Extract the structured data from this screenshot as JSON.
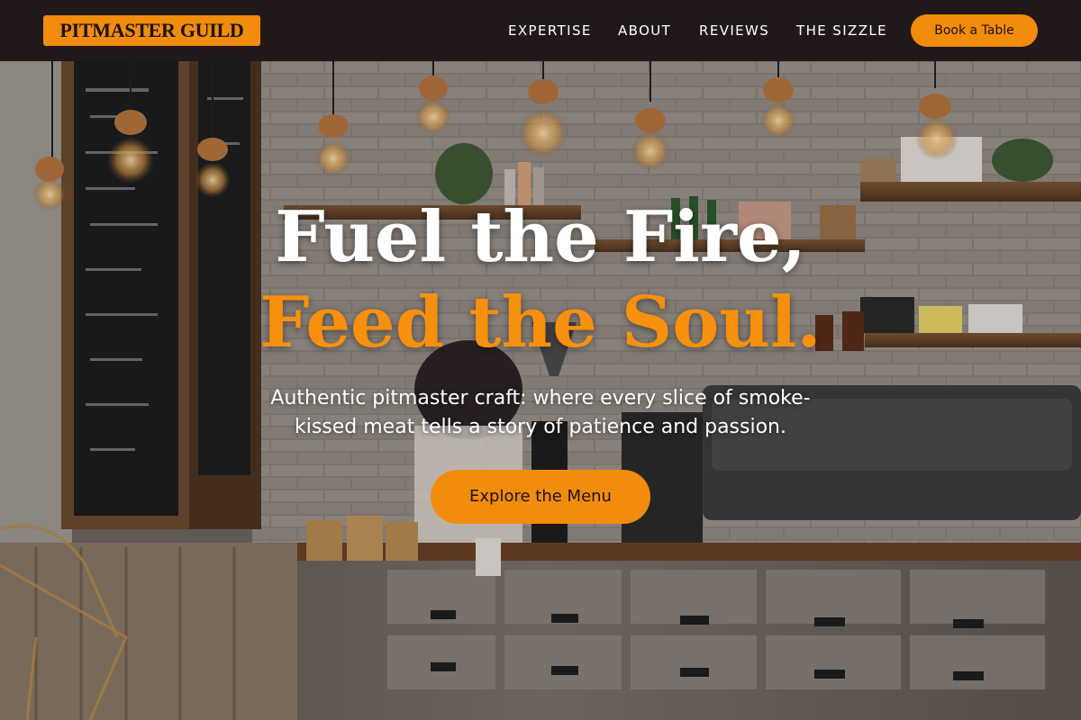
{
  "header": {
    "logo": "PITMASTER GUILD",
    "nav": [
      {
        "label": "EXPERTISE"
      },
      {
        "label": "ABOUT"
      },
      {
        "label": "REVIEWS"
      },
      {
        "label": "THE SIZZLE"
      }
    ],
    "book_button": "Book a Table"
  },
  "hero": {
    "headline_line1": "Fuel the Fire,",
    "headline_line2": "Feed the Soul.",
    "tagline": "Authentic pitmaster craft: where every slice of smoke-kissed meat tells a story of patience and passion.",
    "cta_label": "Explore the Menu",
    "background_image": "cafe-counter-photo"
  },
  "colors": {
    "accent": "#f28c0c",
    "header_bg": "#211919",
    "headline_white": "#ffffff",
    "headline_orange": "#f7900d"
  }
}
